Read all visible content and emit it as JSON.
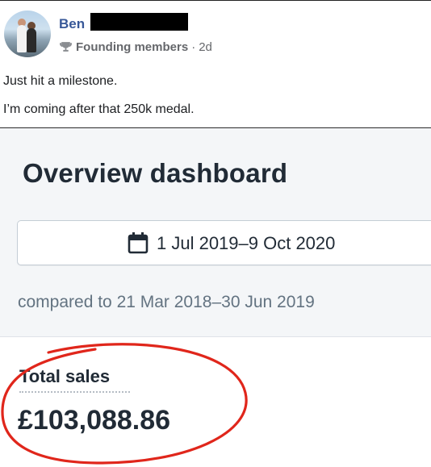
{
  "post": {
    "author_first_name": "Ben",
    "group_name": "Founding members",
    "separator": "·",
    "time_ago": "2d",
    "text_lines": [
      "Just hit a milestone.",
      "I’m coming after that 250k medal."
    ]
  },
  "dashboard": {
    "title": "Overview dashboard",
    "date_range": "1 Jul 2019–9 Oct 2020",
    "compared_to": "compared to 21 Mar 2018–30 Jun 2019",
    "metric": {
      "label": "Total sales",
      "value": "£103,088.86"
    }
  },
  "icons": {
    "group_icon": "trophy-icon",
    "date_icon": "calendar-icon"
  },
  "colors": {
    "author_link": "#385898",
    "highlight_annotation": "#e0261b",
    "dashboard_background": "#f4f6f8",
    "dashboard_text": "#212b36",
    "muted_text": "#637381"
  }
}
